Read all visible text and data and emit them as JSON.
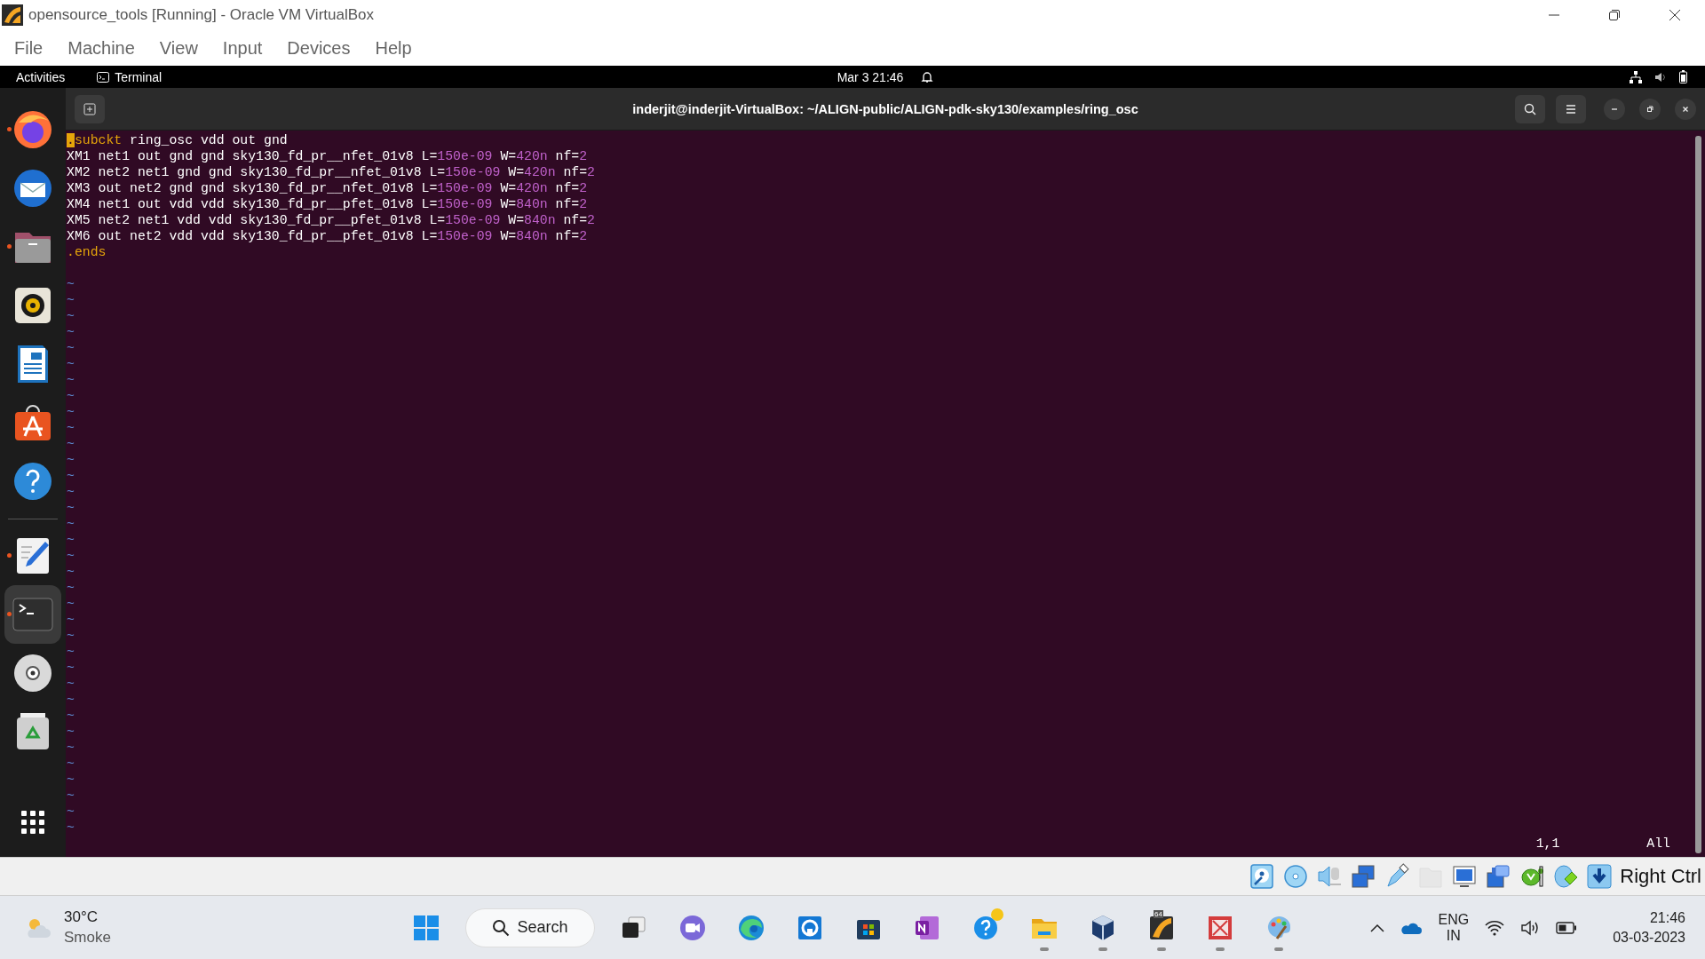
{
  "window": {
    "title": "opensource_tools [Running] - Oracle VM VirtualBox"
  },
  "menu": [
    "File",
    "Machine",
    "View",
    "Input",
    "Devices",
    "Help"
  ],
  "top_bar": {
    "activities": "Activities",
    "app": "Terminal",
    "clock": "Mar 3  21:46"
  },
  "dock": {
    "favorites": [
      {
        "kind": "browser",
        "running": true,
        "selected": false
      },
      {
        "kind": "mail",
        "running": false,
        "selected": false
      },
      {
        "kind": "files",
        "running": true,
        "selected": false
      },
      {
        "kind": "music",
        "running": false,
        "selected": false
      },
      {
        "kind": "writer",
        "running": false,
        "selected": false
      },
      {
        "kind": "store",
        "running": false,
        "selected": false
      },
      {
        "kind": "help",
        "running": false,
        "selected": false
      }
    ],
    "others": [
      {
        "kind": "editor",
        "running": true,
        "selected": false
      },
      {
        "kind": "terminal",
        "running": true,
        "selected": true
      },
      {
        "kind": "disc",
        "running": false,
        "selected": false
      },
      {
        "kind": "trash",
        "running": false,
        "selected": false
      }
    ]
  },
  "terminal": {
    "title": "inderjit@inderjit-VirtualBox: ~/ALIGN-public/ALIGN-pdk-sky130/examples/ring_osc",
    "lines": [
      {
        "segments": [
          {
            "kind": "keyword",
            "text": ".",
            "cursor": true
          },
          {
            "kind": "keyword",
            "text": "subckt"
          },
          {
            "kind": "plain",
            "text": " ring_osc vdd out gnd"
          }
        ]
      },
      {
        "segments": [
          {
            "kind": "plain",
            "text": "XM1 net1 out gnd gnd sky130_fd_pr__nfet_01v8 L="
          },
          {
            "kind": "number",
            "text": "150e-09"
          },
          {
            "kind": "plain",
            "text": " W="
          },
          {
            "kind": "number",
            "text": "420n"
          },
          {
            "kind": "plain",
            "text": " nf="
          },
          {
            "kind": "number",
            "text": "2"
          }
        ]
      },
      {
        "segments": [
          {
            "kind": "plain",
            "text": "XM2 net2 net1 gnd gnd sky130_fd_pr__nfet_01v8 L="
          },
          {
            "kind": "number",
            "text": "150e-09"
          },
          {
            "kind": "plain",
            "text": " W="
          },
          {
            "kind": "number",
            "text": "420n"
          },
          {
            "kind": "plain",
            "text": " nf="
          },
          {
            "kind": "number",
            "text": "2"
          }
        ]
      },
      {
        "segments": [
          {
            "kind": "plain",
            "text": "XM3 out net2 gnd gnd sky130_fd_pr__nfet_01v8 L="
          },
          {
            "kind": "number",
            "text": "150e-09"
          },
          {
            "kind": "plain",
            "text": " W="
          },
          {
            "kind": "number",
            "text": "420n"
          },
          {
            "kind": "plain",
            "text": " nf="
          },
          {
            "kind": "number",
            "text": "2"
          }
        ]
      },
      {
        "segments": [
          {
            "kind": "plain",
            "text": "XM4 net1 out vdd vdd sky130_fd_pr__pfet_01v8 L="
          },
          {
            "kind": "number",
            "text": "150e-09"
          },
          {
            "kind": "plain",
            "text": " W="
          },
          {
            "kind": "number",
            "text": "840n"
          },
          {
            "kind": "plain",
            "text": " nf="
          },
          {
            "kind": "number",
            "text": "2"
          }
        ]
      },
      {
        "segments": [
          {
            "kind": "plain",
            "text": "XM5 net2 net1 vdd vdd sky130_fd_pr__pfet_01v8 L="
          },
          {
            "kind": "number",
            "text": "150e-09"
          },
          {
            "kind": "plain",
            "text": " W="
          },
          {
            "kind": "number",
            "text": "840n"
          },
          {
            "kind": "plain",
            "text": " nf="
          },
          {
            "kind": "number",
            "text": "2"
          }
        ]
      },
      {
        "segments": [
          {
            "kind": "plain",
            "text": "XM6 out net2 vdd vdd sky130_fd_pr__pfet_01v8 L="
          },
          {
            "kind": "number",
            "text": "150e-09"
          },
          {
            "kind": "plain",
            "text": " W="
          },
          {
            "kind": "number",
            "text": "840n"
          },
          {
            "kind": "plain",
            "text": " nf="
          },
          {
            "kind": "number",
            "text": "2"
          }
        ]
      },
      {
        "segments": [
          {
            "kind": "keyword",
            "text": ".ends"
          }
        ]
      }
    ],
    "empty_markers": [
      "~",
      "~",
      "~",
      "~",
      "~",
      "~",
      "~",
      "~",
      "~",
      "~",
      "~",
      "~",
      "~",
      "~",
      "~",
      "~",
      "~",
      "~",
      "~",
      "~",
      "~",
      "~",
      "~",
      "~",
      "~",
      "~",
      "~",
      "~",
      "~",
      "~",
      "~",
      "~",
      "~",
      "~",
      "~"
    ],
    "ruler": "1,1",
    "position": "All"
  },
  "vm_status": {
    "indicators": [
      {
        "kind": "disk",
        "disabled": false
      },
      {
        "kind": "optical",
        "disabled": false
      },
      {
        "kind": "audio",
        "disabled": false
      },
      {
        "kind": "network",
        "disabled": false
      },
      {
        "kind": "usb",
        "disabled": false
      },
      {
        "kind": "shared",
        "disabled": true
      },
      {
        "kind": "display",
        "disabled": false
      },
      {
        "kind": "capture",
        "disabled": false
      },
      {
        "kind": "turtle",
        "disabled": false
      },
      {
        "kind": "mouse",
        "disabled": false
      },
      {
        "kind": "keyboard",
        "disabled": false
      }
    ],
    "host_key": "Right Ctrl"
  },
  "taskbar": {
    "weather": {
      "temp": "30°C",
      "condition": "Smoke"
    },
    "search": "Search",
    "apps": [
      {
        "kind": "start",
        "running": false
      },
      {
        "kind": "taskview",
        "running": false
      },
      {
        "kind": "chat",
        "running": false
      },
      {
        "kind": "edge",
        "running": false
      },
      {
        "kind": "app",
        "running": false
      },
      {
        "kind": "store",
        "running": false
      },
      {
        "kind": "notebook",
        "running": false
      },
      {
        "kind": "tips",
        "running": false,
        "notification": true
      },
      {
        "kind": "explorer",
        "running": true
      },
      {
        "kind": "cube",
        "running": true
      },
      {
        "kind": "badged",
        "running": true,
        "badge": "64"
      },
      {
        "kind": "frame",
        "running": true
      },
      {
        "kind": "palette",
        "running": true
      }
    ],
    "tray": {
      "language": "ENG",
      "region": "IN",
      "time": "21:46",
      "date": "03-03-2023"
    }
  }
}
